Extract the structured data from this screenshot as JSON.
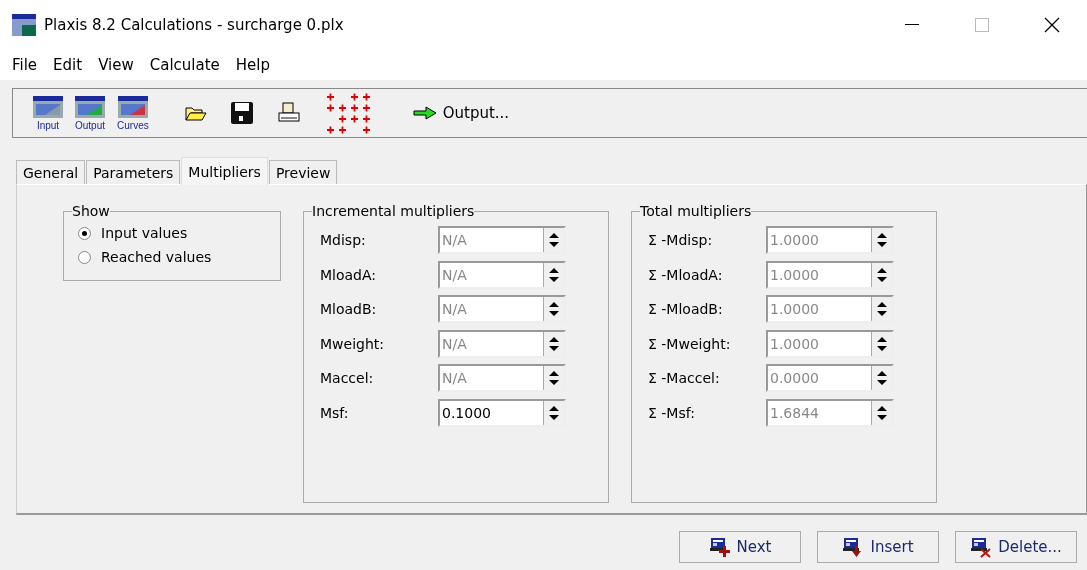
{
  "window": {
    "title": "Plaxis 8.2 Calculations - surcharge 0.plx"
  },
  "menu": [
    "File",
    "Edit",
    "View",
    "Calculate",
    "Help"
  ],
  "toolbar": {
    "launchers": [
      {
        "label": "Input",
        "kind": "input"
      },
      {
        "label": "Output",
        "kind": "output"
      },
      {
        "label": "Curves",
        "kind": "curves"
      }
    ],
    "output_button": "Output..."
  },
  "tabs": [
    {
      "label": "General",
      "selected": false
    },
    {
      "label": "Parameters",
      "selected": false
    },
    {
      "label": "Multipliers",
      "selected": true
    },
    {
      "label": "Preview",
      "selected": false
    }
  ],
  "show": {
    "title": "Show",
    "options": [
      {
        "label": "Input values",
        "selected": true
      },
      {
        "label": "Reached values",
        "selected": false
      }
    ]
  },
  "groups": [
    {
      "title": "Incremental multipliers",
      "fields": [
        {
          "label": "Mdisp:",
          "value": "N/A",
          "disabled": true
        },
        {
          "label": "MloadA:",
          "value": "N/A",
          "disabled": true
        },
        {
          "label": "MloadB:",
          "value": "N/A",
          "disabled": true
        },
        {
          "label": "Mweight:",
          "value": "N/A",
          "disabled": true
        },
        {
          "label": "Maccel:",
          "value": "N/A",
          "disabled": true
        },
        {
          "label": "Msf:",
          "value": "0.1000",
          "disabled": false
        }
      ]
    },
    {
      "title": "Total multipliers",
      "fields": [
        {
          "label": "Σ -Mdisp:",
          "value": "1.0000",
          "disabled": true
        },
        {
          "label": "Σ -MloadA:",
          "value": "1.0000",
          "disabled": true
        },
        {
          "label": "Σ -MloadB:",
          "value": "1.0000",
          "disabled": true
        },
        {
          "label": "Σ -Mweight:",
          "value": "1.0000",
          "disabled": true
        },
        {
          "label": "Σ -Maccel:",
          "value": "0.0000",
          "disabled": true
        },
        {
          "label": "Σ -Msf:",
          "value": "1.6844",
          "disabled": true
        }
      ]
    }
  ],
  "buttons": [
    {
      "label": "Next",
      "kind": "next"
    },
    {
      "label": "Insert",
      "kind": "insert"
    },
    {
      "label": "Delete...",
      "kind": "delete"
    }
  ]
}
